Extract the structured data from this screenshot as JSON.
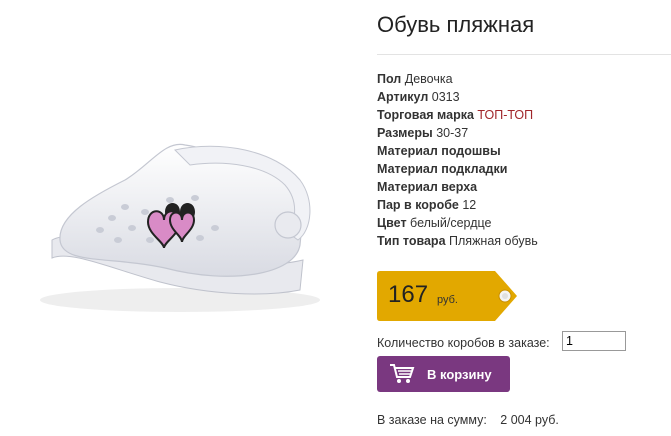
{
  "product": {
    "title": "Обувь пляжная"
  },
  "specs": [
    {
      "label": "Пол",
      "value": "Девочка"
    },
    {
      "label": "Артикул",
      "value": "0313"
    },
    {
      "label": "Торговая марка",
      "value": "ТОП-ТОП"
    },
    {
      "label": "Размеры",
      "value": "30-37"
    },
    {
      "label": "Материал подошвы",
      "value": ""
    },
    {
      "label": "Материал подкладки",
      "value": ""
    },
    {
      "label": "Материал верха",
      "value": ""
    },
    {
      "label": "Пар в коробе",
      "value": "12"
    },
    {
      "label": "Цвет",
      "value": "белый/сердце"
    },
    {
      "label": "Тип товара",
      "value": "Пляжная обувь"
    }
  ],
  "price": {
    "value": "167",
    "currency": "руб."
  },
  "order": {
    "qty_label": "Количество коробов в заказе:",
    "qty_value": "1",
    "cart_button": "В корзину",
    "total_label": "В заказе на сумму:",
    "total_amount": "2 004 руб."
  },
  "colors": {
    "price_tag": "#e2a800",
    "cart_button": "#7a3880",
    "brand_link": "#a0252a"
  },
  "icons": {
    "cart": "shopping-cart-icon",
    "product": "product-image"
  }
}
